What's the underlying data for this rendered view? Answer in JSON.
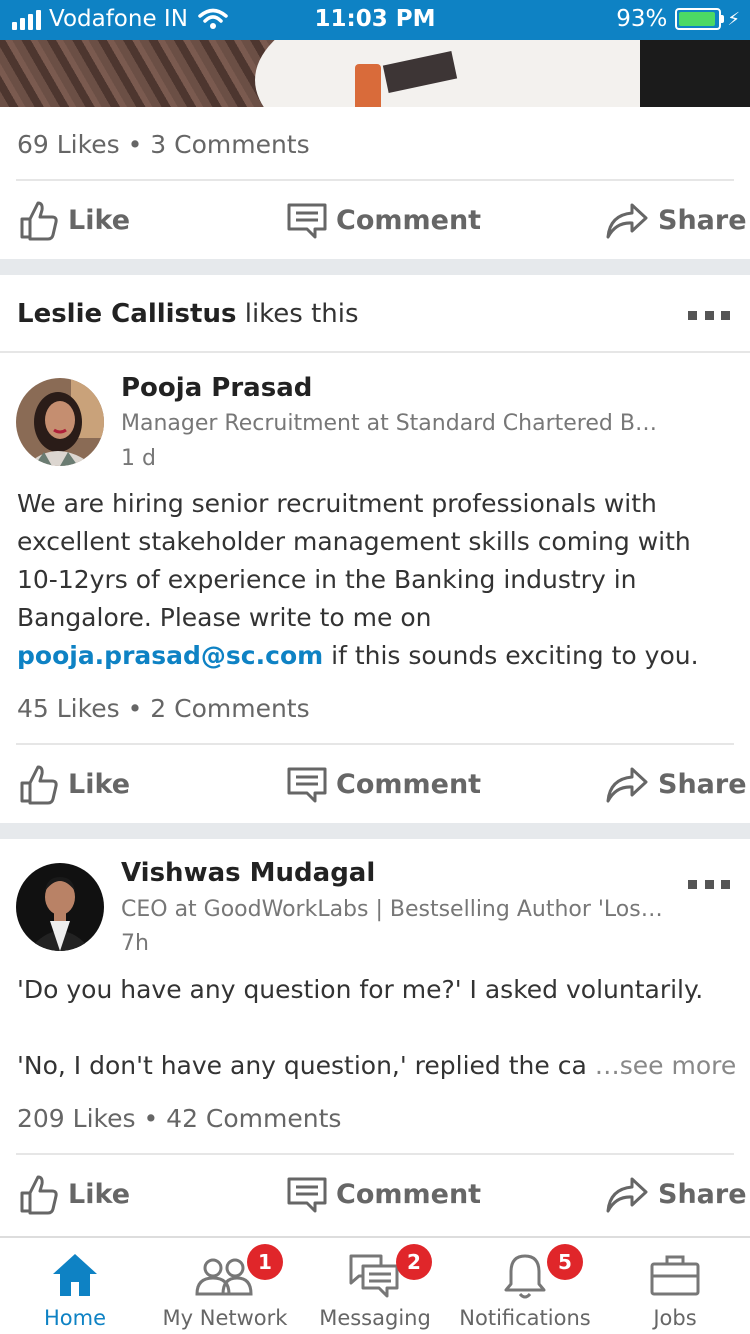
{
  "status_bar": {
    "carrier": "Vodafone IN",
    "time": "11:03 PM",
    "battery": "93%",
    "battery_level": 0.93
  },
  "post1": {
    "counts": "69 Likes • 3 Comments"
  },
  "actions": {
    "like": "Like",
    "comment": "Comment",
    "share": "Share"
  },
  "post2": {
    "liked_by_name": "Leslie Callistus",
    "liked_by_suffix": " likes this",
    "author": "Pooja Prasad",
    "title": "Manager Recruitment at Standard Chartered Bank",
    "time": "1 d",
    "body_before": "We are hiring senior recruitment professionals with excellent stakeholder management skills coming with 10-12yrs of experience in the Banking industry in Bangalore. Please write to me on ",
    "email": "pooja.prasad@sc.com",
    "body_after": " if this sounds exciting to you.",
    "counts": "45 Likes • 2 Comments"
  },
  "post3": {
    "author": "Vishwas Mudagal",
    "title": "CEO at GoodWorkLabs | Bestselling Author 'Losing My Religion'",
    "time": "7h",
    "line1": "'Do you have any question for me?' I asked voluntarily.",
    "line2": "'No, I don't have any question,' replied the ca",
    "see_more": "…see more",
    "counts": "209 Likes • 42 Comments"
  },
  "tabbar": {
    "home": "Home",
    "network": "My Network",
    "network_badge": "1",
    "messaging": "Messaging",
    "messaging_badge": "2",
    "notifications": "Notifications",
    "notifications_badge": "5",
    "jobs": "Jobs"
  },
  "colors": {
    "brand": "#0e82c4",
    "badge": "#e0262a",
    "battery": "#4cd964"
  }
}
